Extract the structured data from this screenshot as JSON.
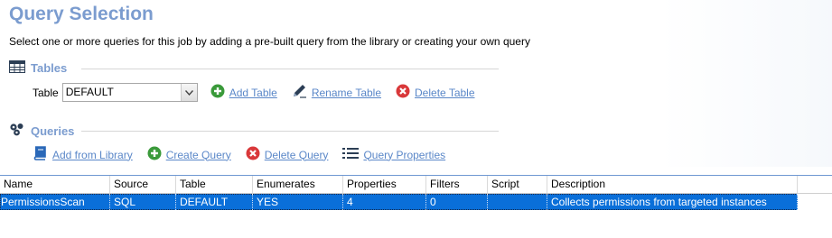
{
  "title": "Query Selection",
  "subtitle": "Select one or more queries for this job by adding a pre-built query from the library or creating your own query",
  "tables_section": {
    "label": "Tables",
    "table_label": "Table",
    "selected_table": "DEFAULT",
    "actions": {
      "add": "Add Table",
      "rename": "Rename Table",
      "delete": "Delete Table"
    }
  },
  "queries_section": {
    "label": "Queries",
    "actions": {
      "add_from_library": "Add from Library",
      "create": "Create Query",
      "delete": "Delete Query",
      "properties": "Query Properties"
    }
  },
  "grid": {
    "columns": [
      "Name",
      "Source",
      "Table",
      "Enumerates",
      "Properties",
      "Filters",
      "Script",
      "Description"
    ],
    "rows": [
      {
        "name": "PermissionsScan",
        "source": "SQL",
        "table": "DEFAULT",
        "enumerates": "YES",
        "properties": "4",
        "filters": "0",
        "script": "",
        "description": "Collects permissions from targeted instances"
      }
    ]
  },
  "colors": {
    "heading": "#7b9ccf",
    "link": "#5a87c8",
    "add_green": "#3a9a3a",
    "delete_red": "#d9383a",
    "selection_blue": "#0a6fd9"
  }
}
